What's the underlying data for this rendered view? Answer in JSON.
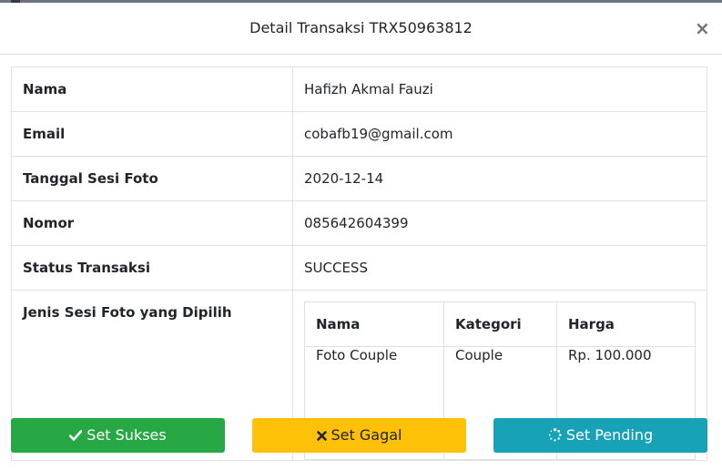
{
  "modal": {
    "title": "Detail Transaksi TRX50963812",
    "close_label": "×"
  },
  "details": [
    {
      "label": "Nama",
      "value": "Hafizh Akmal Fauzi"
    },
    {
      "label": "Email",
      "value": "cobafb19@gmail.com"
    },
    {
      "label": "Tanggal Sesi Foto",
      "value": "2020-12-14"
    },
    {
      "label": "Nomor",
      "value": "085642604399"
    },
    {
      "label": "Status Transaksi",
      "value": "SUCCESS"
    },
    {
      "label": "Jenis Sesi Foto yang Dipilih"
    }
  ],
  "packages": {
    "headers": [
      "Nama",
      "Kategori",
      "Harga"
    ],
    "rows": [
      [
        "Foto Couple",
        "Couple",
        "Rp. 100.000"
      ]
    ]
  },
  "buttons": {
    "success": {
      "label": "Set Sukses",
      "icon": "check-icon",
      "color": "#28a745"
    },
    "fail": {
      "label": "Set Gagal",
      "icon": "times-icon",
      "color": "#ffc107"
    },
    "pending": {
      "label": "Set Pending",
      "icon": "spinner-icon",
      "color": "#17a2b8"
    }
  }
}
